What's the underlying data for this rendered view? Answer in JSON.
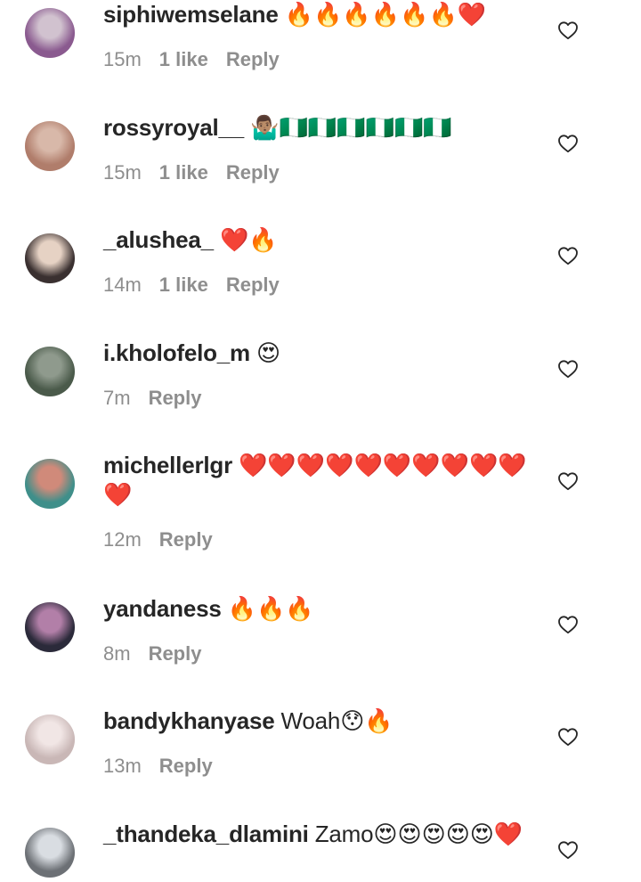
{
  "reply_label": "Reply",
  "comments": [
    {
      "username": "siphiwemselane",
      "text": "",
      "emoji": "🔥🔥🔥🔥🔥🔥❤️",
      "time": "15m",
      "likes": "1 like",
      "reply": "Reply",
      "avatar_colors": [
        "#8a5a8f",
        "#d1c2cf"
      ]
    },
    {
      "username": "rossyroyal__",
      "text": "",
      "emoji": "🤷🏽‍♂️🇳🇬🇳🇬🇳🇬🇳🇬🇳🇬🇳🇬",
      "time": "15m",
      "likes": "1 like",
      "reply": "Reply",
      "avatar_colors": [
        "#b07d6b",
        "#d8b8a9"
      ]
    },
    {
      "username": "_alushea_",
      "text": "",
      "emoji": "❤️🔥",
      "time": "14m",
      "likes": "1 like",
      "reply": "Reply",
      "avatar_colors": [
        "#3a3030",
        "#e6d2c4"
      ]
    },
    {
      "username": "i.kholofelo_m",
      "text": "",
      "emoji": "😍",
      "time": "7m",
      "likes": "",
      "reply": "Reply",
      "avatar_colors": [
        "#4a5a4a",
        "#8f9a8d"
      ]
    },
    {
      "username": "michellerlgr",
      "text": "",
      "emoji": "❤️❤️❤️❤️❤️❤️❤️❤️❤️❤️❤️",
      "time": "12m",
      "likes": "",
      "reply": "Reply",
      "avatar_colors": [
        "#3f8f8a",
        "#d08a7a"
      ]
    },
    {
      "username": "yandaness",
      "text": "",
      "emoji": "🔥🔥🔥",
      "time": "8m",
      "likes": "",
      "reply": "Reply",
      "avatar_colors": [
        "#2b2a3a",
        "#b27fa8"
      ]
    },
    {
      "username": "bandykhanyase",
      "text": "Woah",
      "emoji": "😯🔥",
      "time": "13m",
      "likes": "",
      "reply": "Reply",
      "avatar_colors": [
        "#c9b7b6",
        "#f1e6e5"
      ]
    },
    {
      "username": "_thandeka_dlamini",
      "text": "Zamo",
      "emoji": "😍😍😍😍😍❤️",
      "time": "",
      "likes": "",
      "reply": "",
      "avatar_colors": [
        "#6c7075",
        "#d9dde2"
      ]
    }
  ]
}
